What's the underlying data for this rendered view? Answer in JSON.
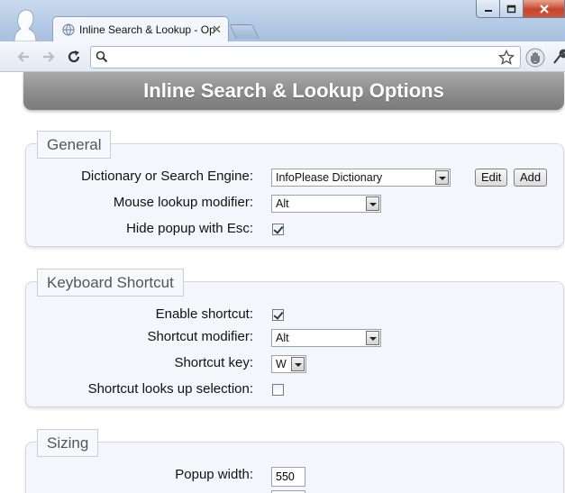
{
  "window": {
    "tab_title": "Inline Search & Lookup - Options",
    "colors": {
      "accent": "#b3c9e4",
      "close": "#c7452a"
    }
  },
  "toolbar": {
    "address_value": "",
    "icons": [
      "back-arrow-icon",
      "forward-arrow-icon",
      "reload-icon",
      "search-icon",
      "star-icon",
      "extension-hand-icon",
      "wrench-icon"
    ]
  },
  "page": {
    "title": "Inline Search & Lookup Options",
    "general": {
      "legend": "General",
      "dictionary_label": "Dictionary or Search Engine:",
      "dictionary_value": "InfoPlease Dictionary",
      "edit_label": "Edit",
      "add_label": "Add",
      "mouse_modifier_label": "Mouse lookup modifier:",
      "mouse_modifier_value": "Alt",
      "hide_popup_label": "Hide popup with Esc:",
      "hide_popup_checked": true
    },
    "keyboard": {
      "legend": "Keyboard Shortcut",
      "enable_label": "Enable shortcut:",
      "enable_checked": true,
      "modifier_label": "Shortcut modifier:",
      "modifier_value": "Alt",
      "key_label": "Shortcut key:",
      "key_value": "W",
      "selection_label": "Shortcut looks up selection:",
      "selection_checked": false
    },
    "sizing": {
      "legend": "Sizing",
      "popup_width_label": "Popup width:",
      "popup_width_value": "550"
    }
  }
}
